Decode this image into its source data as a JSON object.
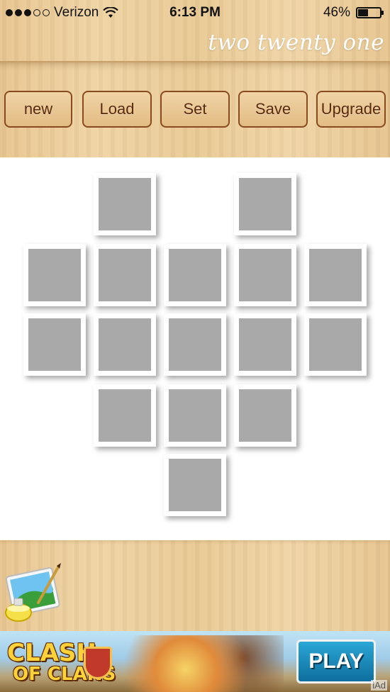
{
  "status_bar": {
    "carrier": "Verizon",
    "time": "6:13 PM",
    "battery_percent": "46%",
    "battery_level": 0.46,
    "signal_bars_filled": 3,
    "signal_bars_total": 5
  },
  "header": {
    "brand": "two twenty one"
  },
  "toolbar": {
    "new_label": "new",
    "load_label": "Load",
    "set_label": "Set",
    "save_label": "Save",
    "upgrade_label": "Upgrade"
  },
  "collage": {
    "layout": "heart",
    "tile_count": 15,
    "placeholder_color": "#a9a9a9"
  },
  "bottom_panel": {
    "icon": "paint-palette-icon"
  },
  "ad": {
    "logo_line1": "CLASH",
    "logo_line2": "OF CLANS",
    "play_label": "PLAY",
    "network_tag": "iAd"
  },
  "colors": {
    "wood": "#ecce9c",
    "button_border": "#8a4a1f",
    "button_text": "#5a2a0c",
    "brand_text": "#ffffff"
  }
}
